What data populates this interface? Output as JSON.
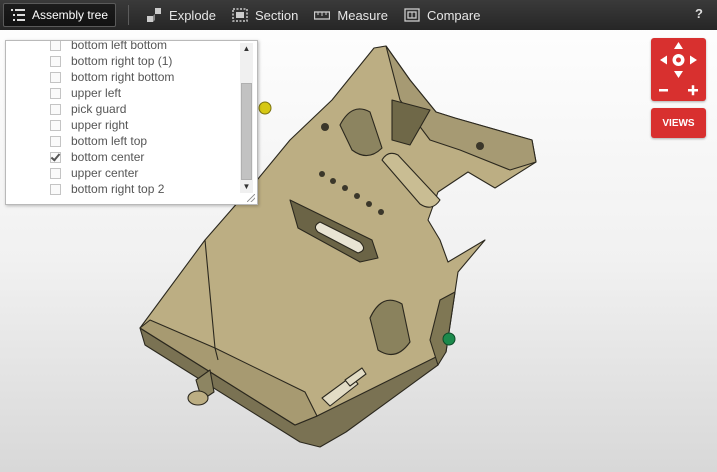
{
  "toolbar": {
    "assembly_tree": "Assembly tree",
    "explode": "Explode",
    "section": "Section",
    "measure": "Measure",
    "compare": "Compare",
    "help": "?"
  },
  "tree": {
    "items": [
      {
        "label": "bottom left bottom",
        "checked": false
      },
      {
        "label": "bottom right top (1)",
        "checked": false
      },
      {
        "label": "bottom right bottom",
        "checked": false
      },
      {
        "label": "upper left",
        "checked": false
      },
      {
        "label": "pick guard",
        "checked": false
      },
      {
        "label": "upper right",
        "checked": false
      },
      {
        "label": "bottom left top",
        "checked": false
      },
      {
        "label": "bottom center",
        "checked": true
      },
      {
        "label": "upper center",
        "checked": false
      },
      {
        "label": "bottom right top 2",
        "checked": false
      }
    ]
  },
  "views_label": "VIEWS",
  "colors": {
    "part_fill": "#bcae83",
    "part_dark": "#716a4c",
    "accent_red": "#d8302f",
    "marker_yellow": "#d6c814",
    "marker_green": "#1c8a4c"
  }
}
